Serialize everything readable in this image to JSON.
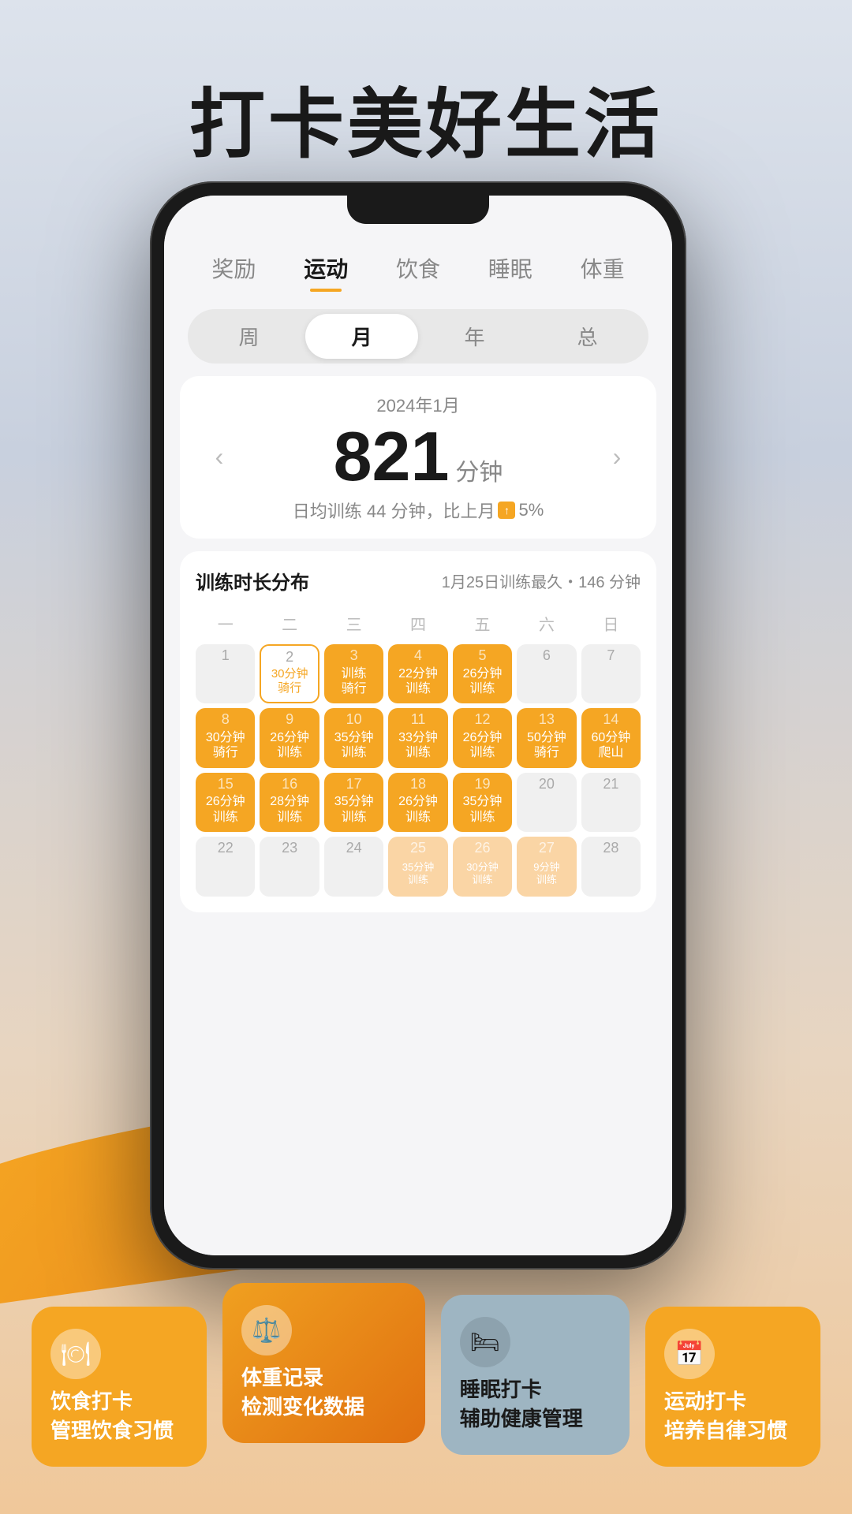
{
  "header": {
    "title": "打卡美好生活"
  },
  "nav": {
    "tabs": [
      {
        "label": "奖励",
        "active": false
      },
      {
        "label": "运动",
        "active": true
      },
      {
        "label": "饮食",
        "active": false
      },
      {
        "label": "睡眠",
        "active": false
      },
      {
        "label": "体重",
        "active": false
      }
    ]
  },
  "period": {
    "tabs": [
      {
        "label": "周",
        "active": false
      },
      {
        "label": "月",
        "active": true
      },
      {
        "label": "年",
        "active": false
      },
      {
        "label": "总",
        "active": false
      }
    ]
  },
  "stats": {
    "date": "2024年1月",
    "value": "821",
    "unit": "分钟",
    "sub": "日均训练 44 分钟，比上月",
    "change": "5%",
    "prev_label": "‹",
    "next_label": "›"
  },
  "calendar": {
    "title": "训练时长分布",
    "subtitle": "1月25日训练最久・146 分钟",
    "day_headers": [
      "一",
      "二",
      "三",
      "四",
      "五",
      "六",
      "日"
    ],
    "rows": [
      [
        {
          "num": "1",
          "label": "",
          "type": "gray"
        },
        {
          "num": "2",
          "label": "30分钟\n骑行",
          "type": "outline"
        },
        {
          "num": "3",
          "label": "训练\n骑行",
          "type": "orange"
        },
        {
          "num": "4",
          "label": "22分钟\n训练",
          "type": "orange"
        },
        {
          "num": "5",
          "label": "26分钟\n训练",
          "type": "orange"
        },
        {
          "num": "6",
          "label": "",
          "type": "gray"
        },
        {
          "num": "7",
          "label": "",
          "type": "gray"
        }
      ],
      [
        {
          "num": "8",
          "label": "30分钟\n骑行",
          "type": "orange"
        },
        {
          "num": "9",
          "label": "26分钟\n训练",
          "type": "orange"
        },
        {
          "num": "10",
          "label": "35分钟\n训练",
          "type": "orange"
        },
        {
          "num": "11",
          "label": "33分钟\n训练",
          "type": "orange"
        },
        {
          "num": "12",
          "label": "26分钟\n训练",
          "type": "orange"
        },
        {
          "num": "13",
          "label": "50分钟\n骑行",
          "type": "orange"
        },
        {
          "num": "14",
          "label": "60分钟\n爬山",
          "type": "orange"
        }
      ],
      [
        {
          "num": "15",
          "label": "26分钟\n训练",
          "type": "orange"
        },
        {
          "num": "16",
          "label": "28分钟\n训练",
          "type": "orange"
        },
        {
          "num": "17",
          "label": "35分钟\n训练",
          "type": "orange"
        },
        {
          "num": "18",
          "label": "26分钟\n训练",
          "type": "orange"
        },
        {
          "num": "19",
          "label": "35分钟\n训练",
          "type": "orange"
        },
        {
          "num": "20",
          "label": "",
          "type": "gray"
        },
        {
          "num": "21",
          "label": "",
          "type": "gray"
        }
      ],
      [
        {
          "num": "22",
          "label": "",
          "type": "gray"
        },
        {
          "num": "23",
          "label": "",
          "type": "gray"
        },
        {
          "num": "24",
          "label": "",
          "type": "gray"
        },
        {
          "num": "25",
          "label": "35分钟\n训练",
          "type": "light"
        },
        {
          "num": "26",
          "label": "30分钟\n训练",
          "type": "light"
        },
        {
          "num": "27",
          "label": "9分钟\n训练",
          "type": "light"
        },
        {
          "num": "28",
          "label": "",
          "type": "gray"
        }
      ]
    ]
  },
  "bottom_cards": [
    {
      "id": "food",
      "icon": "🍽",
      "text": "饮食打卡\n管理饮食习惯",
      "color": "orange"
    },
    {
      "id": "weight",
      "icon": "⚖",
      "text": "体重记录\n检测变化数据",
      "color": "orange-dark"
    },
    {
      "id": "sleep",
      "icon": "🛏",
      "text": "睡眠打卡\n辅助健康管理",
      "color": "gray-blue"
    },
    {
      "id": "exercise",
      "icon": "📅",
      "text": "运动打卡\n培养自律习惯",
      "color": "orange"
    }
  ]
}
